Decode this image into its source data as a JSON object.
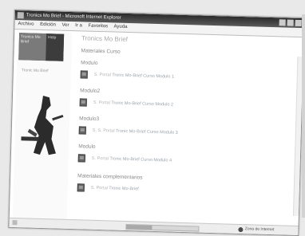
{
  "window": {
    "title": "Tronics Mo Brief - Microsoft Internet Explorer",
    "menu": [
      "Archivo",
      "Edición",
      "Ver",
      "Ir a",
      "Favoritos",
      "Ayuda"
    ]
  },
  "sidebar": {
    "logo_left": "Tronics Mo Brief",
    "logo_right": "Help",
    "link_text": "Tronic Mo Brief"
  },
  "main": {
    "page_title": "Tronics Mo Brief",
    "section_title": "Materiales Curso",
    "modules": [
      {
        "label": "Modulo",
        "doc_text": "S. Portal",
        "doc_link": "Tronic Mo-Brief Curso Modulo 1"
      },
      {
        "label": "Modulo2",
        "doc_text": "S. Portal",
        "doc_link": "Tronic Mo-Brief Curso Modulo 2"
      },
      {
        "label": "Modulo3",
        "doc_text": "S. S. Portal",
        "doc_link": "Tronic Mo-Brief Curso Modulo 3"
      },
      {
        "label": "Modulo",
        "doc_text": "S. Portal",
        "doc_link": "Tronic Mo-Brief Curso Modulo 4"
      }
    ],
    "footer_section_title": "Materiales complementarios",
    "footer_doc_text": "S. Portal",
    "footer_doc_link": "Tronic Mo-Brief"
  },
  "status": {
    "progress": 0.35,
    "zone": "Zona de Internet"
  }
}
